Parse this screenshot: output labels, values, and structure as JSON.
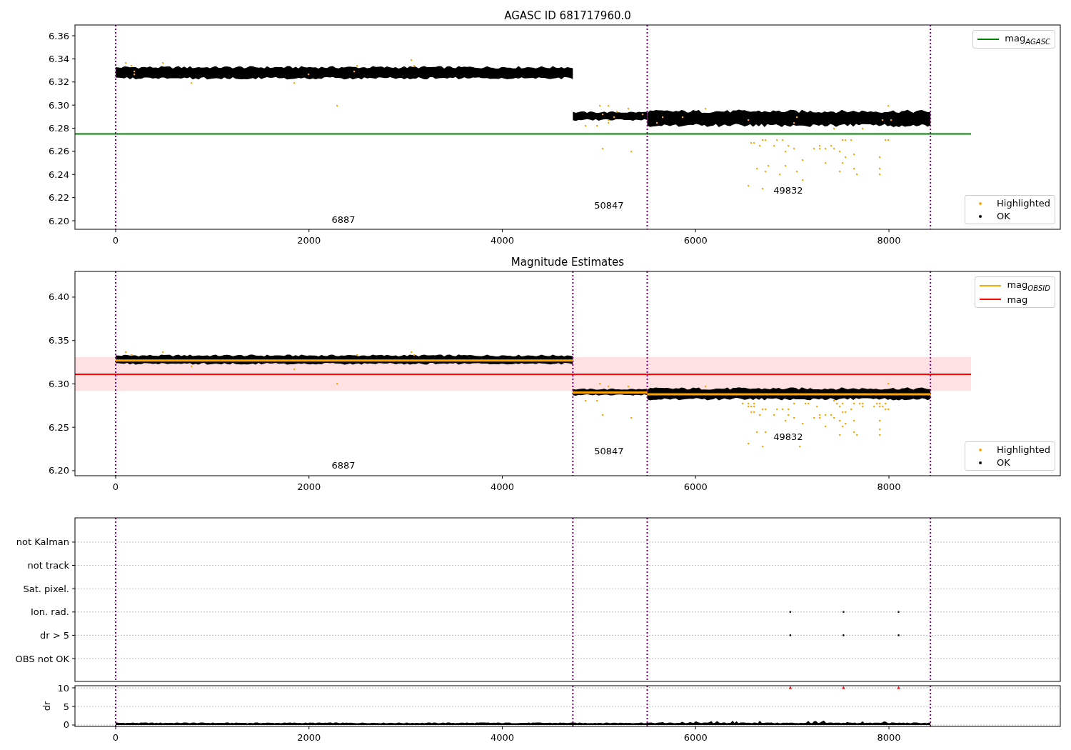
{
  "panels": [
    {
      "kind": "magnitude",
      "chart_data": {
        "type": "line",
        "title": "AGASC ID 681717960.0",
        "xlim": [
          -421,
          9773
        ],
        "ylim": [
          6.1926,
          6.3693
        ],
        "xticks": [
          0,
          2000,
          4000,
          6000,
          8000
        ],
        "yticks": [
          {
            "value": 6.2,
            "label": "6.20"
          },
          {
            "value": 6.22,
            "label": "6.22"
          },
          {
            "value": 6.24,
            "label": "6.24"
          },
          {
            "value": 6.26,
            "label": "6.26"
          },
          {
            "value": 6.28,
            "label": "6.28"
          },
          {
            "value": 6.3,
            "label": "6.30"
          },
          {
            "value": 6.32,
            "label": "6.32"
          },
          {
            "value": 6.34,
            "label": "6.34"
          },
          {
            "value": 6.36,
            "label": "6.36"
          }
        ],
        "x": [
          -420,
          8850
        ],
        "series": [
          {
            "name": "mag$_{AGASC}$",
            "color": "#008000",
            "values": [
              6.275,
              6.275
            ]
          }
        ],
        "annotations": [
          "6887",
          "50847",
          "49832"
        ]
      },
      "legend": [
        {
          "label": "Highlighted",
          "color": "#ffa500"
        },
        {
          "label": "OK",
          "color": "#000000"
        }
      ]
    },
    {
      "kind": "magnitude",
      "chart_data": {
        "type": "line",
        "title": "Magnitude Estimates",
        "xlim": [
          -421,
          9773
        ],
        "ylim": [
          6.1942,
          6.4296
        ],
        "xticks": [
          0,
          2000,
          4000,
          6000,
          8000
        ],
        "yticks": [
          {
            "value": 6.2,
            "label": "6.20"
          },
          {
            "value": 6.25,
            "label": "6.25"
          },
          {
            "value": 6.3,
            "label": "6.30"
          },
          {
            "value": 6.35,
            "label": "6.35"
          },
          {
            "value": 6.4,
            "label": "6.40"
          }
        ],
        "x": [
          -420,
          0,
          4730,
          4730,
          5500,
          5500,
          8430,
          8850
        ],
        "series": [
          {
            "name": "mag$_{OBSID}$",
            "color": "#ffa500",
            "values": [
              null,
              6.327,
              6.327,
              6.29,
              6.29,
              6.288,
              6.288,
              null
            ]
          },
          {
            "name": "mag",
            "color": "#ff0000",
            "values": [
              6.311,
              6.311,
              6.311,
              6.311,
              6.311,
              6.311,
              6.311,
              6.311
            ]
          }
        ],
        "annotations": [
          "6887",
          "50847",
          "49832"
        ]
      },
      "legend": [
        {
          "label": "Highlighted",
          "color": "#ffa500"
        },
        {
          "label": "OK",
          "color": "#000000"
        }
      ]
    },
    {
      "kind": "flags",
      "rows": [
        "not Kalman",
        "not track",
        "Sat. pixel.",
        "Ion. rad.",
        "dr > 5",
        "OBS not OK"
      ]
    },
    {
      "kind": "dr",
      "chart_data": {
        "type": "scatter",
        "ylabel": "dr",
        "xlim": [
          -421,
          9773
        ],
        "ylim": [
          -0.385,
          10.58
        ],
        "xticks": [
          0,
          2000,
          4000,
          6000,
          8000
        ],
        "yticks": [
          0,
          5,
          10
        ],
        "x": [
          6980,
          7530,
          8100
        ],
        "series": [
          {
            "color": "#ff0000",
            "values": [
              10,
              10,
              10
            ]
          }
        ]
      }
    }
  ]
}
